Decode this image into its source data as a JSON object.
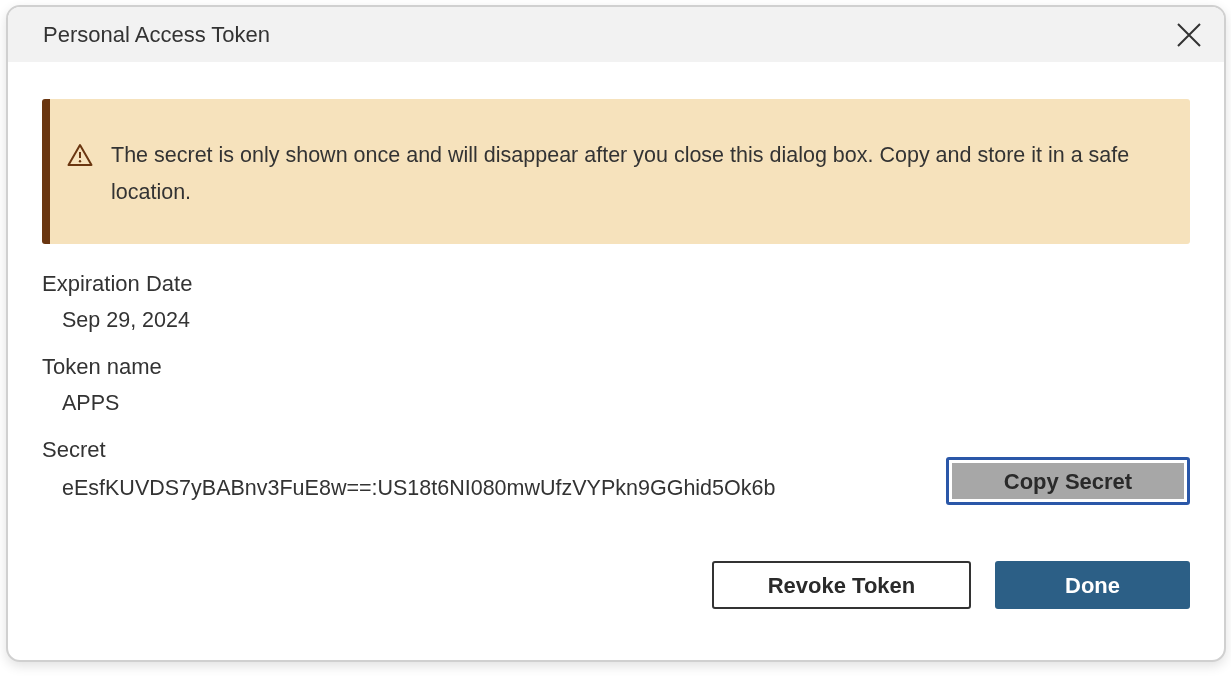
{
  "dialog": {
    "title": "Personal Access Token"
  },
  "alert": {
    "text": "The secret is only shown once and will disappear after you close this dialog box. Copy and store it in a safe location."
  },
  "fields": [
    {
      "label": "Expiration Date",
      "value": "Sep 29, 2024"
    },
    {
      "label": "Token name",
      "value": "APPS"
    },
    {
      "label": "Secret",
      "value": "eEsfKUVDS7yBABnv3FuE8w==:US18t6NI080mwUfzVYPkn9GGhid5Ok6b",
      "button": {
        "label": "Copy Secret",
        "focused": true
      }
    }
  ],
  "buttons": [
    {
      "label": "Revoke Token",
      "kind": "secondary"
    },
    {
      "label": "Done",
      "kind": "primary"
    }
  ]
}
